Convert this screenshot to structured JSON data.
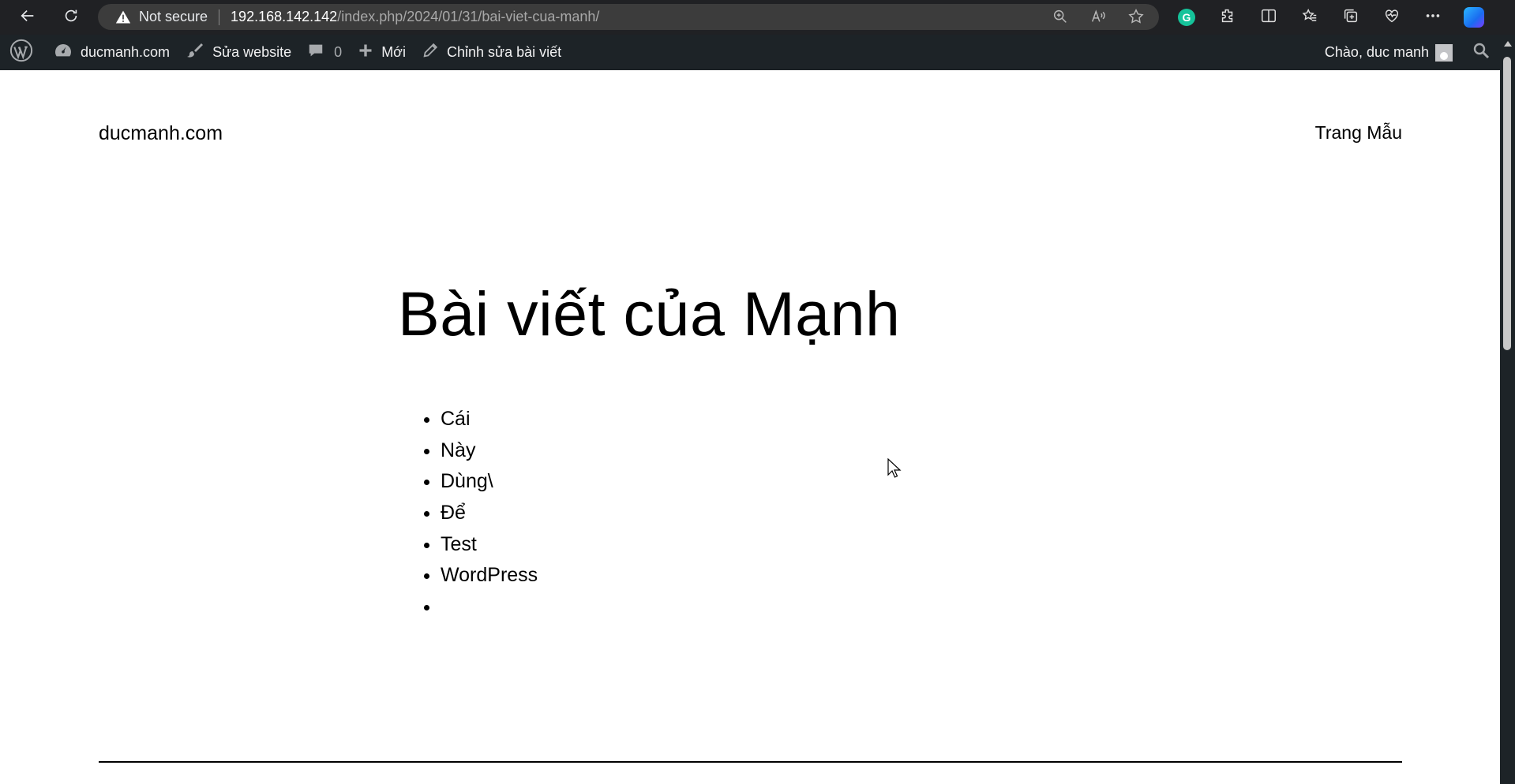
{
  "browser": {
    "security_label": "Not secure",
    "url_host": "192.168.142.142",
    "url_path": "/index.php/2024/01/31/bai-viet-cua-manh/",
    "grammarly_letter": "G",
    "icons": [
      "back-icon",
      "reload-icon",
      "warning-icon",
      "zoom-icon",
      "read-aloud-icon",
      "favorite-star-icon",
      "grammarly-icon",
      "extensions-icon",
      "split-screen-icon",
      "favorites-icon",
      "collections-icon",
      "browser-essentials-icon",
      "more-icon",
      "copilot-icon"
    ]
  },
  "admin_bar": {
    "site_name": "ducmanh.com",
    "customize_label": "Sửa website",
    "comments_count": "0",
    "new_label": "Mới",
    "edit_post_label": "Chỉnh sửa bài viết",
    "greeting": "Chào, duc manh"
  },
  "site": {
    "title": "ducmanh.com",
    "nav_item": "Trang Mẫu"
  },
  "post": {
    "title": "Bài viết của Mạnh",
    "list_items": [
      "Cái",
      "Này",
      "Dùng\\",
      "Để",
      "Test",
      "WordPress",
      ""
    ]
  },
  "colors": {
    "browser_bg": "#202124",
    "address_bg": "#3c3c3c",
    "admin_bar_bg": "#1d2327",
    "page_bg": "#ffffff",
    "text": "#000000"
  }
}
